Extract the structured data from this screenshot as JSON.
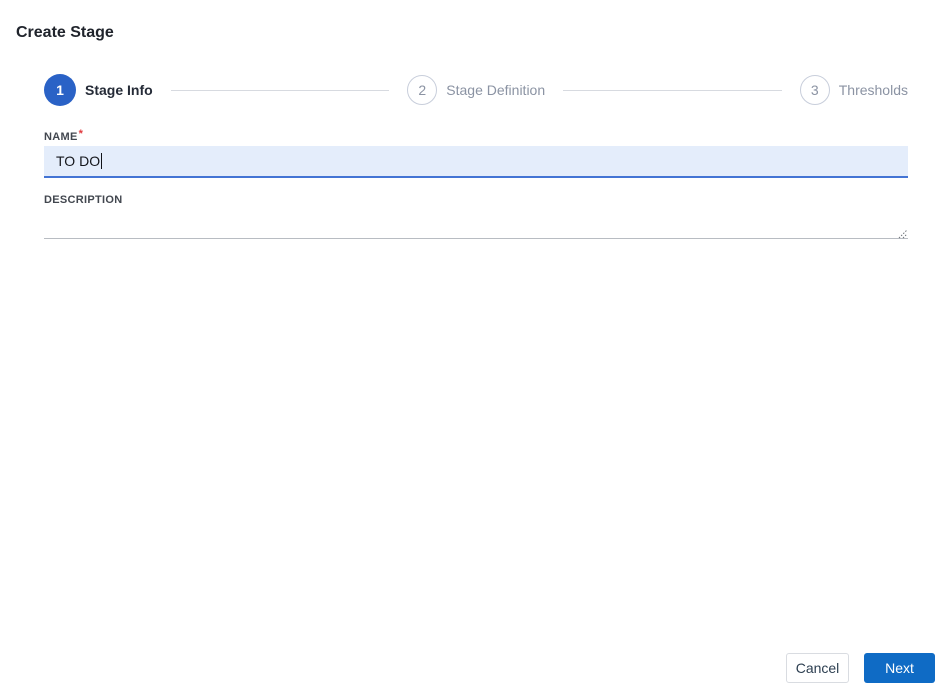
{
  "page": {
    "title": "Create Stage"
  },
  "stepper": {
    "steps": [
      {
        "number": "1",
        "label": "Stage Info",
        "state": "active"
      },
      {
        "number": "2",
        "label": "Stage Definition",
        "state": "inactive"
      },
      {
        "number": "3",
        "label": "Thresholds",
        "state": "inactive"
      }
    ]
  },
  "form": {
    "name_label": "NAME",
    "required_marker": "*",
    "name_value": "TO DO",
    "description_label": "DESCRIPTION",
    "description_value": ""
  },
  "footer": {
    "cancel_label": "Cancel",
    "next_label": "Next"
  },
  "colors": {
    "active_step_blue": "#2a62c6",
    "primary_button_blue": "#0f6bc5",
    "focused_input_bg": "#e4edfb",
    "focused_input_border": "#4374d4",
    "required_red": "#e03a3e",
    "inactive_gray": "#8b93a3"
  }
}
